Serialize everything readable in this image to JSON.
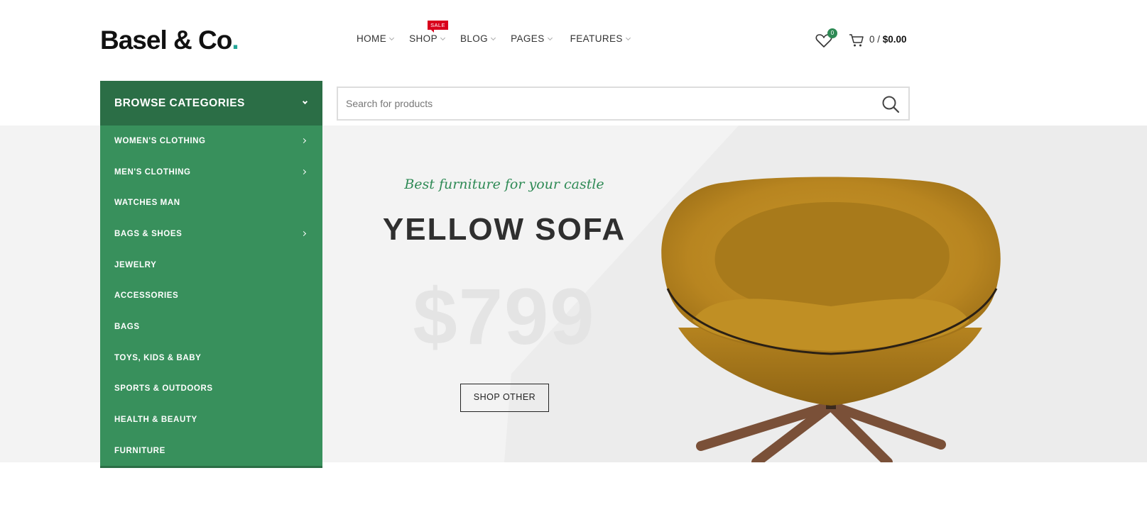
{
  "brand": {
    "name": "Basel & Co",
    "dot": ".",
    "accent": "#23a596"
  },
  "nav": {
    "items": [
      {
        "label": "HOME"
      },
      {
        "label": "SHOP",
        "badge": "SALE"
      },
      {
        "label": "BLOG"
      },
      {
        "label": "PAGES"
      },
      {
        "label": "FEATURES"
      }
    ]
  },
  "header_actions": {
    "wishlist_count": "0",
    "cart_count": "0 /",
    "cart_total": "$0.00"
  },
  "categories": {
    "title": "BROWSE CATEGORIES",
    "items": [
      {
        "label": "WOMEN'S CLOTHING",
        "has_sub": true
      },
      {
        "label": "MEN'S CLOTHING",
        "has_sub": true
      },
      {
        "label": "WATCHES MAN",
        "has_sub": false
      },
      {
        "label": "BAGS & SHOES",
        "has_sub": true
      },
      {
        "label": "JEWELRY",
        "has_sub": false
      },
      {
        "label": "ACCESSORIES",
        "has_sub": false
      },
      {
        "label": "BAGS",
        "has_sub": false
      },
      {
        "label": "TOYS, KIDS & BABY",
        "has_sub": false
      },
      {
        "label": "SPORTS & OUTDOORS",
        "has_sub": false
      },
      {
        "label": "HEALTH & BEAUTY",
        "has_sub": false
      },
      {
        "label": "FURNITURE",
        "has_sub": false
      }
    ]
  },
  "search": {
    "placeholder": "Search for products"
  },
  "hero": {
    "tagline": "Best furniture for your castle",
    "title": "YELLOW SOFA",
    "price": "$799",
    "button": "SHOP OTHER"
  },
  "colors": {
    "category_header": "#2b6e46",
    "category_bg": "#38905c",
    "sale": "#d9001c",
    "hero_bg": "#f3f3f3"
  }
}
